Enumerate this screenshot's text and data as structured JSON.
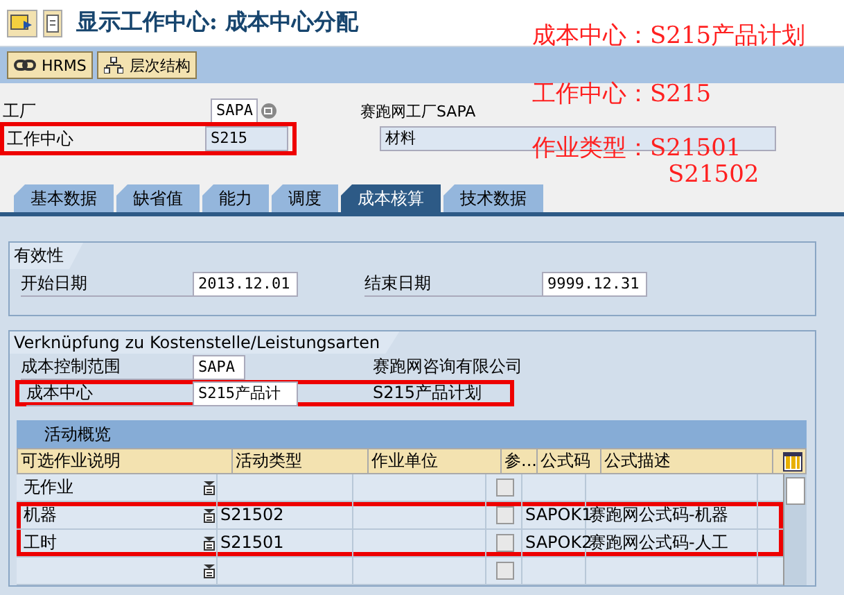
{
  "window": {
    "title": "显示工作中心: 成本中心分配"
  },
  "toolbar": {
    "buttons": [
      {
        "label": "HRMS"
      },
      {
        "label": "层次结构"
      }
    ]
  },
  "header": {
    "plant": {
      "label": "工厂",
      "value": "SAPA",
      "description": "赛跑网工厂SAPA"
    },
    "work_center": {
      "label": "工作中心",
      "value": "S215",
      "description": "材料",
      "highlighted": true
    }
  },
  "tabs": [
    {
      "label": "基本数据",
      "selected": false
    },
    {
      "label": "缺省值",
      "selected": false
    },
    {
      "label": "能力",
      "selected": false
    },
    {
      "label": "调度",
      "selected": false
    },
    {
      "label": "成本核算",
      "selected": true
    },
    {
      "label": "技术数据",
      "selected": false
    }
  ],
  "validity": {
    "title": "有效性",
    "start_label": "开始日期",
    "start": "2013.12.01",
    "end_label": "结束日期",
    "end": "9999.12.31"
  },
  "link": {
    "title": "Verknüpfung zu Kostenstelle/Leistungsarten",
    "controlling_area": {
      "label": "成本控制范围",
      "value": "SAPA",
      "description": "赛跑网咨询有限公司"
    },
    "cost_center": {
      "label": "成本中心",
      "value": "S215产品计",
      "description": "S215产品计划",
      "highlighted": true
    }
  },
  "activities": {
    "title": "活动概览",
    "columns": [
      "可选作业说明",
      "活动类型",
      "作业单位",
      "参...",
      "公式码",
      "公式描述"
    ],
    "rows": [
      {
        "description": "无作业",
        "activity_type": "",
        "unit": "",
        "checked": false,
        "formula": "",
        "formula_text": "",
        "highlighted": false
      },
      {
        "description": "机器",
        "activity_type": "S21502",
        "unit": "",
        "checked": false,
        "formula": "SAPOK1",
        "formula_text": "赛跑网公式码-机器",
        "highlighted": true
      },
      {
        "description": "工时",
        "activity_type": "S21501",
        "unit": "",
        "checked": false,
        "formula": "SAPOK2",
        "formula_text": "赛跑网公式码-人工",
        "highlighted": true
      },
      {
        "description": "",
        "activity_type": "",
        "unit": "",
        "checked": false,
        "formula": "",
        "formula_text": "",
        "highlighted": false
      }
    ]
  },
  "annotations": [
    "成本中心：S215产品计划",
    "工作中心：S215",
    "作业类型：S21501",
    "S21502"
  ]
}
